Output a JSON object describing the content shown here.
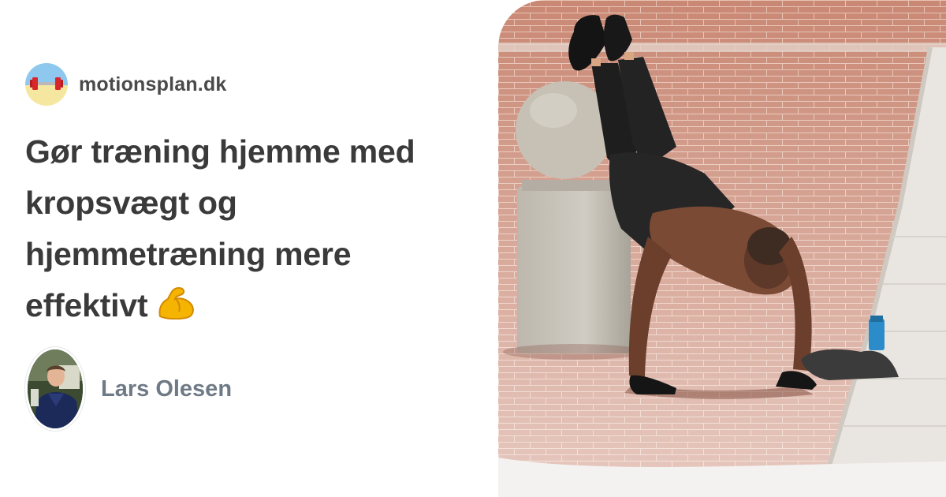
{
  "site": {
    "name": "motionsplan.dk",
    "logo_icon": "dumbbell-icon"
  },
  "headline": {
    "text": "Gør træning hjemme med kropsvægt og hjemmetræning mere effektivt",
    "emoji": "flexed-biceps-icon"
  },
  "author": {
    "name": "Lars Olesen"
  },
  "hero": {
    "subject": "push-up-photo"
  },
  "colors": {
    "headline": "#3a3a3a",
    "site_name": "#4a4a4a",
    "author_name": "#6e7a86",
    "background": "#ffffff"
  }
}
